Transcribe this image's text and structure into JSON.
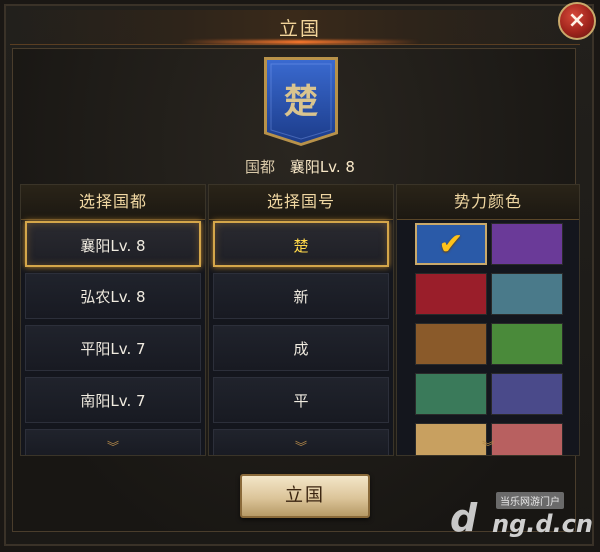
{
  "dialog": {
    "title": "立国",
    "close_label": "×",
    "banner_char": "楚",
    "capital": {
      "label": "国都",
      "value": "襄阳Lv. 8"
    },
    "confirm_label": "立国"
  },
  "columns": {
    "capital": {
      "header": "选择国都",
      "items": [
        "襄阳Lv. 8",
        "弘农Lv. 8",
        "平阳Lv. 7",
        "南阳Lv. 7"
      ],
      "selected": 0
    },
    "name": {
      "header": "选择国号",
      "items": [
        "楚",
        "新",
        "成",
        "平"
      ],
      "selected": 0
    },
    "color": {
      "header": "势力颜色",
      "swatches": [
        "#2a5aa8",
        "#6a3a98",
        "#9a1e2a",
        "#4a7a8a",
        "#8a5a2a",
        "#4a8a3a",
        "#3a7a5a",
        "#4a4a8a",
        "#c8a060",
        "#b86060"
      ],
      "selected": 0,
      "check_icon": "✔"
    },
    "scroll_more": "︾"
  },
  "watermark": {
    "caption": "当乐网游门户",
    "domain": "ng.d.cn",
    "logo": "d"
  },
  "accent": "#d4a64a"
}
